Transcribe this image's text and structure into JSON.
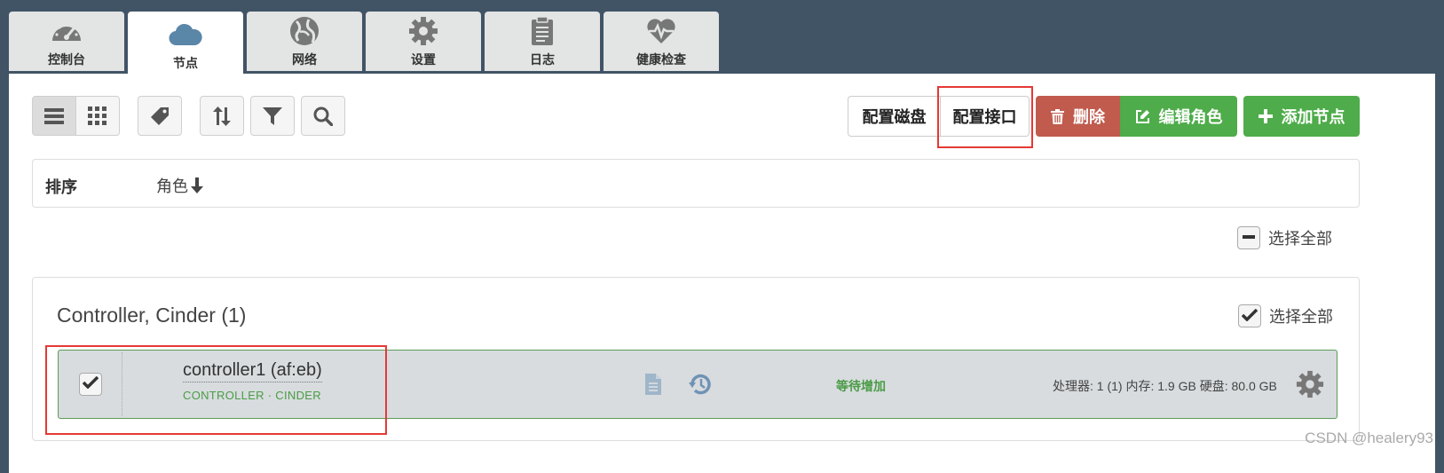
{
  "tabs": [
    {
      "label": "控制台",
      "icon": "dashboard-icon",
      "active": false
    },
    {
      "label": "节点",
      "icon": "cloud-icon",
      "active": true
    },
    {
      "label": "网络",
      "icon": "globe-icon",
      "active": false
    },
    {
      "label": "设置",
      "icon": "gear-icon",
      "active": false
    },
    {
      "label": "日志",
      "icon": "clipboard-icon",
      "active": false
    },
    {
      "label": "健康检查",
      "icon": "heartbeat-icon",
      "active": false
    }
  ],
  "toolbar": {
    "config_disks": "配置磁盘",
    "config_interfaces": "配置接口",
    "delete": "删除",
    "edit_roles": "编辑角色",
    "add_nodes": "添加节点"
  },
  "sort": {
    "label": "排序",
    "role": "角色"
  },
  "select_all": "选择全部",
  "group": {
    "title": "Controller, Cinder (1)",
    "select_all": "选择全部",
    "node": {
      "name": "controller1 (af:eb)",
      "roles": "CONTROLLER · CINDER",
      "status": "等待增加",
      "specs": "处理器: 1 (1) 内存: 1.9 GB 硬盘: 80.0 GB"
    }
  },
  "watermark": "CSDN @healery93",
  "colors": {
    "background": "#415466",
    "delete": "#c05b4d",
    "edit": "#4eac4a",
    "add": "#4eac4a",
    "status_green": "#4a9c45",
    "highlight_red": "#e53935"
  }
}
